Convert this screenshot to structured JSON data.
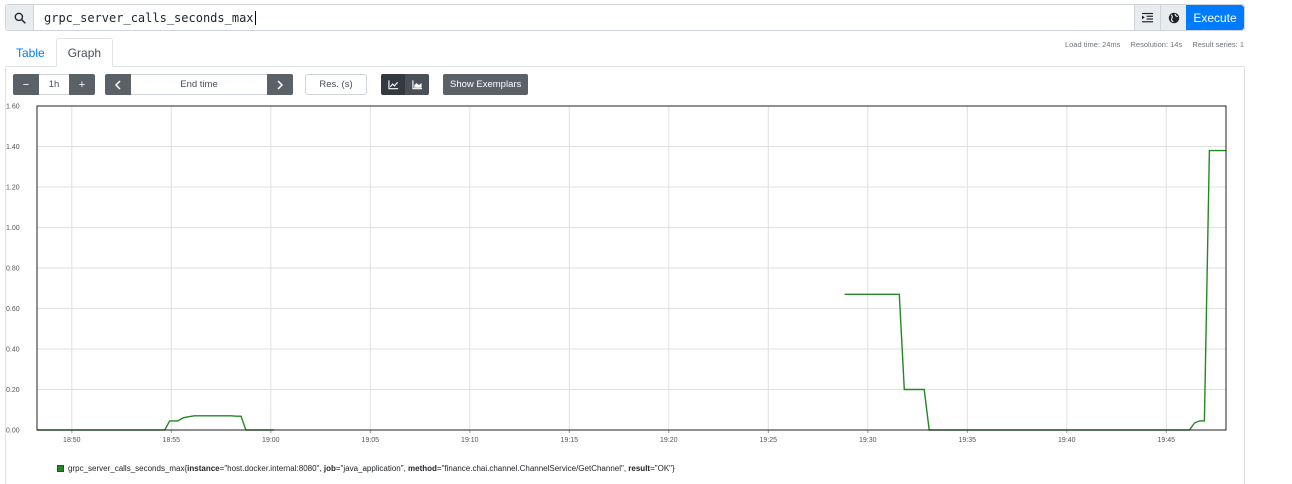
{
  "query": {
    "value": "grpc_server_calls_seconds_max",
    "execute_label": "Execute"
  },
  "icons": {
    "search": "search-icon",
    "format": "indent-icon",
    "explorer": "globe-icon"
  },
  "tabs": [
    {
      "label": "Table",
      "active": false
    },
    {
      "label": "Graph",
      "active": true
    }
  ],
  "stats": {
    "load_time": "Load time: 24ms",
    "resolution": "Resolution: 14s",
    "result_series": "Result series: 1"
  },
  "controls": {
    "minus": "−",
    "range": "1h",
    "plus": "+",
    "prev": "‹",
    "end_time_placeholder": "End time",
    "next": "›",
    "resolution_placeholder": "Res. (s)",
    "show_exemplars": "Show Exemplars"
  },
  "colors": {
    "accent": "#007bff",
    "series": "#228822",
    "dark_button": "#5a6268"
  },
  "chart_data": {
    "type": "line",
    "x_ticks": [
      "18:50",
      "18:55",
      "19:00",
      "19:05",
      "19:10",
      "19:15",
      "19:20",
      "19:25",
      "19:30",
      "19:35",
      "19:40",
      "19:45"
    ],
    "xlim": [
      "18:48:15",
      "19:48:00"
    ],
    "y_ticks": [
      "0.00",
      "0.20",
      "0.40",
      "0.60",
      "0.80",
      "1.00",
      "1.20",
      "1.40",
      "1.60"
    ],
    "ylim": [
      0,
      1.6
    ],
    "grid": true,
    "series": [
      {
        "legend_prefix": "grpc_server_calls_seconds_max{",
        "labels": [
          {
            "key": "instance",
            "value": "\"host.docker.internal:8080\""
          },
          {
            "key": "job",
            "value": "\"java_application\""
          },
          {
            "key": "method",
            "value": "\"finance.chai.channel.ChannelService/GetChannel\""
          },
          {
            "key": "result",
            "value": "\"OK\""
          }
        ],
        "legend_suffix": "}",
        "segments": [
          [
            [
              "18:48:15",
              0
            ],
            [
              "18:54:40",
              0
            ],
            [
              "18:54:55",
              0.045
            ],
            [
              "18:55:20",
              0.045
            ],
            [
              "18:55:35",
              0.06
            ],
            [
              "18:55:50",
              0.065
            ],
            [
              "18:56:10",
              0.07
            ],
            [
              "18:58:00",
              0.07
            ],
            [
              "18:58:15",
              0.068
            ],
            [
              "18:58:30",
              0.068
            ],
            [
              "18:58:45",
              0
            ],
            [
              "19:00:10",
              0
            ]
          ],
          [
            [
              "19:28:50",
              0.67
            ],
            [
              "19:31:35",
              0.67
            ],
            [
              "19:31:50",
              0.2
            ],
            [
              "19:32:50",
              0.2
            ],
            [
              "19:33:05",
              0
            ],
            [
              "19:46:10",
              0
            ],
            [
              "19:46:25",
              0.035
            ],
            [
              "19:46:40",
              0.045
            ],
            [
              "19:46:55",
              0.045
            ],
            [
              "19:47:10",
              1.38
            ],
            [
              "19:48:00",
              1.38
            ]
          ]
        ]
      }
    ]
  }
}
